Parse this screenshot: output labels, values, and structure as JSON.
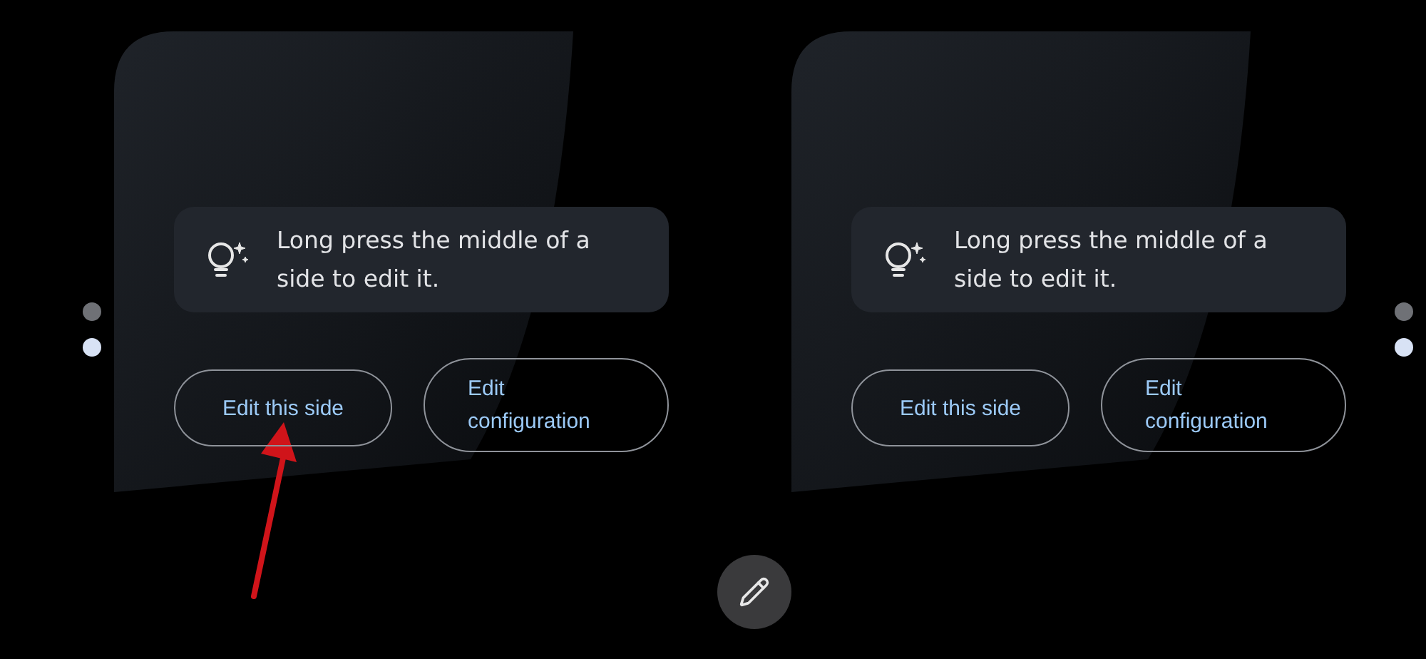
{
  "panels": [
    {
      "page_dots": [
        {
          "selected": false
        },
        {
          "selected": true
        }
      ],
      "tip": {
        "text": "Long press the middle of a side to edit it."
      },
      "buttons": [
        {
          "label": "Edit this side"
        },
        {
          "label": "Edit configuration"
        }
      ]
    },
    {
      "page_dots": [
        {
          "selected": false
        },
        {
          "selected": true
        }
      ],
      "tip": {
        "text": "Long press the middle of a side to edit it."
      },
      "buttons": [
        {
          "label": "Edit this side"
        },
        {
          "label": "Edit configuration"
        }
      ]
    }
  ]
}
